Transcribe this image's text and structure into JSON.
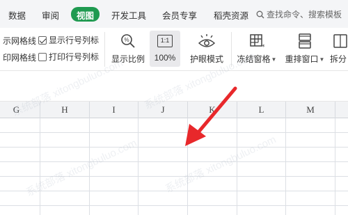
{
  "menu": {
    "items": [
      "数据",
      "审阅",
      "视图",
      "开发工具",
      "会员专享",
      "稻壳资源"
    ],
    "active": "视图",
    "search_text": "查找命令、搜索模板"
  },
  "ribbon": {
    "checks": [
      {
        "label": "示网格线",
        "checked": null
      },
      {
        "label": "显示行号列标",
        "checked": true
      },
      {
        "label": "印网格线",
        "checked": null
      },
      {
        "label": "打印行号列标",
        "checked": false
      }
    ],
    "buttons": {
      "zoom_label": "显示比例",
      "zoom100_label": "100%",
      "zoom100_icon_text": "1:1",
      "eye_label": "护眼模式",
      "freeze_label": "冻结窗格",
      "arrange_label": "重排窗口",
      "split_label": "拆分"
    }
  },
  "sheet": {
    "columns": [
      "G",
      "H",
      "I",
      "J",
      "K",
      "L",
      "M"
    ]
  },
  "annotation": {
    "arrow_color": "#e8282b"
  },
  "watermark": "系统部落 xitongbuluo.com",
  "colors": {
    "accent": "#1f9a50",
    "menu_bg": "#f4f5f7",
    "header_bg": "#f2f3f5"
  }
}
